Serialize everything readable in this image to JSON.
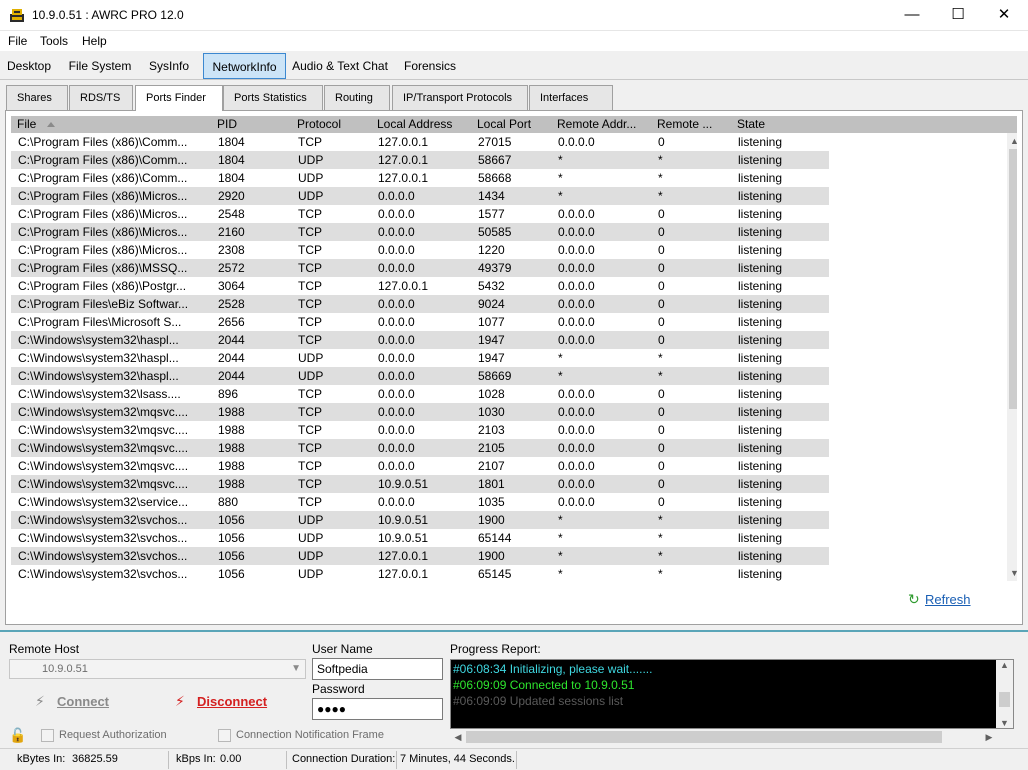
{
  "window": {
    "title": "10.9.0.51 : AWRC PRO 12.0",
    "minimize_glyph": "—",
    "maximize_glyph": "☐",
    "close_glyph": "✕"
  },
  "menu": [
    "File",
    "Tools",
    "Help"
  ],
  "main_tabs": [
    "Desktop",
    "File System",
    "SysInfo",
    "NetworkInfo",
    "Audio & Text Chat",
    "Forensics"
  ],
  "main_tab_active": "NetworkInfo",
  "sub_tabs": [
    "Shares",
    "RDS/TS",
    "Ports Finder",
    "Ports Statistics",
    "Routing",
    "IP/Transport Protocols",
    "Interfaces"
  ],
  "sub_tab_active": "Ports Finder",
  "table": {
    "columns": [
      "File",
      "PID",
      "Protocol",
      "Local Address",
      "Local Port",
      "Remote Addr...",
      "Remote ...",
      "State"
    ],
    "sort_column": "File",
    "rows": [
      [
        "C:\\Program Files (x86)\\Comm...",
        "1804",
        "TCP",
        "127.0.0.1",
        "27015",
        "0.0.0.0",
        "0",
        "listening"
      ],
      [
        "C:\\Program Files (x86)\\Comm...",
        "1804",
        "UDP",
        "127.0.0.1",
        "58667",
        "*",
        "*",
        "listening"
      ],
      [
        "C:\\Program Files (x86)\\Comm...",
        "1804",
        "UDP",
        "127.0.0.1",
        "58668",
        "*",
        "*",
        "listening"
      ],
      [
        "C:\\Program Files (x86)\\Micros...",
        "2920",
        "UDP",
        "0.0.0.0",
        "1434",
        "*",
        "*",
        "listening"
      ],
      [
        "C:\\Program Files (x86)\\Micros...",
        "2548",
        "TCP",
        "0.0.0.0",
        "1577",
        "0.0.0.0",
        "0",
        "listening"
      ],
      [
        "C:\\Program Files (x86)\\Micros...",
        "2160",
        "TCP",
        "0.0.0.0",
        "50585",
        "0.0.0.0",
        "0",
        "listening"
      ],
      [
        "C:\\Program Files (x86)\\Micros...",
        "2308",
        "TCP",
        "0.0.0.0",
        "1220",
        "0.0.0.0",
        "0",
        "listening"
      ],
      [
        "C:\\Program Files (x86)\\MSSQ...",
        "2572",
        "TCP",
        "0.0.0.0",
        "49379",
        "0.0.0.0",
        "0",
        "listening"
      ],
      [
        "C:\\Program Files (x86)\\Postgr...",
        "3064",
        "TCP",
        "127.0.0.1",
        "5432",
        "0.0.0.0",
        "0",
        "listening"
      ],
      [
        "C:\\Program Files\\eBiz Softwar...",
        "2528",
        "TCP",
        "0.0.0.0",
        "9024",
        "0.0.0.0",
        "0",
        "listening"
      ],
      [
        "C:\\Program Files\\Microsoft S...",
        "2656",
        "TCP",
        "0.0.0.0",
        "1077",
        "0.0.0.0",
        "0",
        "listening"
      ],
      [
        "C:\\Windows\\system32\\haspl...",
        "2044",
        "TCP",
        "0.0.0.0",
        "1947",
        "0.0.0.0",
        "0",
        "listening"
      ],
      [
        "C:\\Windows\\system32\\haspl...",
        "2044",
        "UDP",
        "0.0.0.0",
        "1947",
        "*",
        "*",
        "listening"
      ],
      [
        "C:\\Windows\\system32\\haspl...",
        "2044",
        "UDP",
        "0.0.0.0",
        "58669",
        "*",
        "*",
        "listening"
      ],
      [
        "C:\\Windows\\system32\\lsass....",
        "896",
        "TCP",
        "0.0.0.0",
        "1028",
        "0.0.0.0",
        "0",
        "listening"
      ],
      [
        "C:\\Windows\\system32\\mqsvc....",
        "1988",
        "TCP",
        "0.0.0.0",
        "1030",
        "0.0.0.0",
        "0",
        "listening"
      ],
      [
        "C:\\Windows\\system32\\mqsvc....",
        "1988",
        "TCP",
        "0.0.0.0",
        "2103",
        "0.0.0.0",
        "0",
        "listening"
      ],
      [
        "C:\\Windows\\system32\\mqsvc....",
        "1988",
        "TCP",
        "0.0.0.0",
        "2105",
        "0.0.0.0",
        "0",
        "listening"
      ],
      [
        "C:\\Windows\\system32\\mqsvc....",
        "1988",
        "TCP",
        "0.0.0.0",
        "2107",
        "0.0.0.0",
        "0",
        "listening"
      ],
      [
        "C:\\Windows\\system32\\mqsvc....",
        "1988",
        "TCP",
        "10.9.0.51",
        "1801",
        "0.0.0.0",
        "0",
        "listening"
      ],
      [
        "C:\\Windows\\system32\\service...",
        "880",
        "TCP",
        "0.0.0.0",
        "1035",
        "0.0.0.0",
        "0",
        "listening"
      ],
      [
        "C:\\Windows\\system32\\svchos...",
        "1056",
        "UDP",
        "10.9.0.51",
        "1900",
        "*",
        "*",
        "listening"
      ],
      [
        "C:\\Windows\\system32\\svchos...",
        "1056",
        "UDP",
        "10.9.0.51",
        "65144",
        "*",
        "*",
        "listening"
      ],
      [
        "C:\\Windows\\system32\\svchos...",
        "1056",
        "UDP",
        "127.0.0.1",
        "1900",
        "*",
        "*",
        "listening"
      ],
      [
        "C:\\Windows\\system32\\svchos...",
        "1056",
        "UDP",
        "127.0.0.1",
        "65145",
        "*",
        "*",
        "listening"
      ]
    ]
  },
  "refresh_label": "Refresh",
  "connection": {
    "remote_host_label": "Remote Host",
    "remote_host_value": "10.9.0.51",
    "connect_label": "Connect",
    "disconnect_label": "Disconnect",
    "request_auth_label": "Request Authorization",
    "notify_frame_label": "Connection Notification Frame",
    "user_name_label": "User Name",
    "user_name_value": "Softpedia",
    "password_label": "Password",
    "password_value": "●●●●"
  },
  "progress": {
    "label": "Progress Report:",
    "lines": [
      {
        "text": "#06:08:34 Initializing, please wait.......",
        "color": "#3fd7e0"
      },
      {
        "text": "#06:09:09 Connected to 10.9.0.51",
        "color": "#2ee52e"
      },
      {
        "text": "#06:09:09 Updated sessions list",
        "color": "#5a5a5a"
      }
    ]
  },
  "status": {
    "kbytes_in_label": "kBytes In:",
    "kbytes_in_value": "36825.59",
    "kbps_in_label": "kBps In:",
    "kbps_in_value": "0.00",
    "duration_label": "Connection Duration:",
    "duration_value": "7 Minutes, 44 Seconds."
  },
  "colors": {
    "active_tab_bg": "#cce4f7",
    "active_tab_border": "#3c88d0",
    "alt_row": "#dedede",
    "header_bg": "#c0c0c0",
    "disconnect_red": "#d42020",
    "refresh_link": "#1a5fb4"
  }
}
